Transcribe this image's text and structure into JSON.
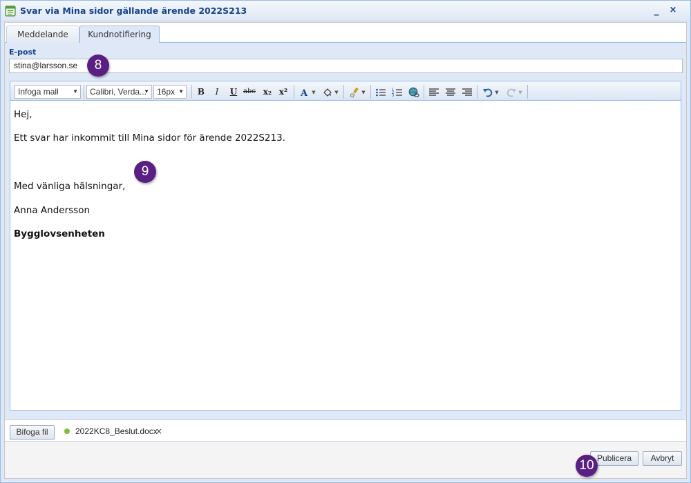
{
  "window": {
    "title": "Svar via Mina sidor gällande ärende 2022S213",
    "minimize_glyph": "_",
    "close_glyph": "×"
  },
  "tabs": [
    {
      "label": "Meddelande",
      "active": false
    },
    {
      "label": "Kundnotifiering",
      "active": true
    }
  ],
  "email": {
    "label": "E-post",
    "value": "stina@larsson.se"
  },
  "toolbar": {
    "template_combo": "Infoga mall",
    "font_combo": "Calibri, Verda...",
    "size_combo": "16px",
    "bold": "B",
    "italic": "I",
    "underline": "U",
    "strike": "abc",
    "subscript": "x₂",
    "superscript": "x²"
  },
  "editor": {
    "lines": [
      "Hej,",
      "Ett svar har inkommit till Mina sidor för ärende 2022S213.",
      "Med vänliga hälsningar,",
      "Anna Andersson",
      "Bygglovsenheten"
    ]
  },
  "attachment": {
    "button_label": "Bifoga fil",
    "file_name": "2022KC8_Beslut.docx",
    "remove_glyph": "×",
    "status_color": "#7fbf3a"
  },
  "footer": {
    "publish_label": "Publicera",
    "cancel_label": "Avbryt"
  },
  "callouts": [
    "8",
    "9",
    "10"
  ],
  "colors": {
    "accent": "#15428b",
    "callout": "#5a1f82",
    "panel": "#dfe8f6"
  }
}
